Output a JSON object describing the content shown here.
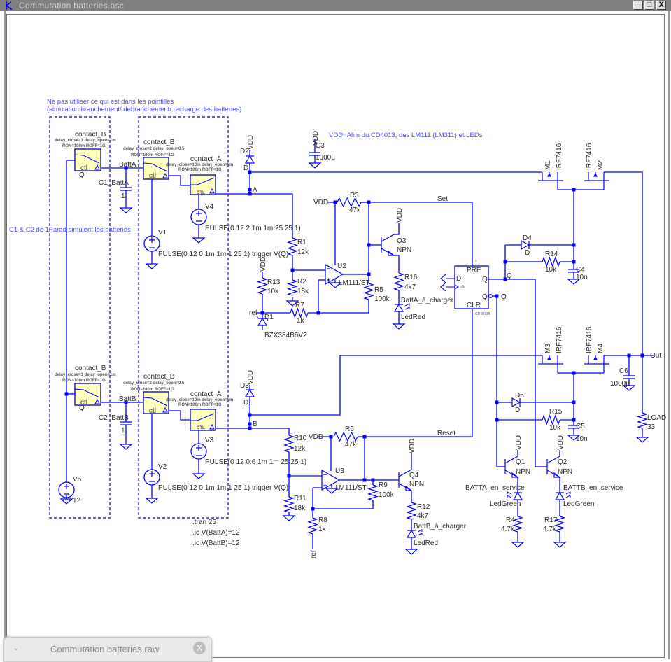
{
  "window": {
    "title": "Commutation batteries.asc",
    "buttons": {
      "minimize": "_",
      "maximize": "□",
      "close": "X"
    }
  },
  "bottom_tab": {
    "title": "Commutation batteries.raw",
    "close": "X",
    "chevron": "⌄"
  },
  "colors": {
    "wire": "#0000ff",
    "comment": "#4848ff",
    "switch_fill": "#ffffc0",
    "titlebar": "#808080"
  },
  "comments": {
    "note1": "Ne pas utiliser ce qui est dans les pointilles",
    "note2": "(simulation branchement/ debranchement/ recharge des batteries)",
    "note3": "C1 & C2 de 1Farad simulent les batteries",
    "note4": "VDD=Alim du CD4013, des LM111 (LM311) et LEDs"
  },
  "directives": {
    "tran": ".tran 25",
    "ic_a": ".ic V(BattA)=12",
    "ic_b": ".ic V(BattB)=12"
  },
  "switches": {
    "sw1": {
      "name": "contact_B",
      "p1": "delay_close=1 delay_open=1m",
      "p2": "RON=100m ROFF=1G",
      "ctl": "ctl",
      "pin": "Q̄"
    },
    "sw2": {
      "name": "contact_B",
      "p1": "delay_close=2 delay_open=0.5",
      "p2": "RON=100m ROFF=1G",
      "ctl": "ctl"
    },
    "sw3": {
      "name": "contact_A",
      "p1": "delay_close=10m delay_open=5m",
      "p2": "RON=100m ROFF=1G",
      "ctl": "CTL"
    },
    "sw4": {
      "name": "contact_B",
      "p1": "delay_close=1 delay_open=1m",
      "p2": "RON=100m ROFF=1G",
      "ctl": "ctl",
      "pin": "Q"
    },
    "sw5": {
      "name": "contact_B",
      "p1": "delay_close=2 delay_open=0.5",
      "p2": "RON=100m ROFF=1G",
      "ctl": "ctl"
    },
    "sw6": {
      "name": "contact_A",
      "p1": "delay_close=10m delay_open=5m",
      "p2": "RON=100m ROFF=1G",
      "ctl": "CTL"
    }
  },
  "nets": {
    "batta": "BattA",
    "battb": "BattB",
    "a": "A",
    "b": "B",
    "set": "Set",
    "reset": "Reset",
    "q": "Q",
    "qbar": "Q̄",
    "out": "Out",
    "ref1": "ref",
    "ref2": "ref"
  },
  "sources": {
    "v1": {
      "name": "V1",
      "value": "PULSE(0 12 0 1m 1m 1 25 1) trigger V(Q)"
    },
    "v2": {
      "name": "V2",
      "value": "PULSE(0 12 0 1m 1m 1 25 1) trigger V̄(Q)"
    },
    "v3": {
      "name": "V3",
      "value": "PULSE(0 12 0.6 1m 1m 25 25 1)"
    },
    "v4": {
      "name": "V4",
      "value": "PULSE(0 12 2 1m 1m 25 25 1)"
    },
    "v5": {
      "name": "V5",
      "value": "12"
    }
  },
  "capacitors": {
    "c1": {
      "name": "C1_BattA",
      "value": "1"
    },
    "c2": {
      "name": "C2_BattB",
      "value": "1"
    },
    "c3": {
      "name": "C3",
      "value": "1000µ"
    },
    "c4": {
      "name": "C4",
      "value": "10n"
    },
    "c5": {
      "name": "C5",
      "value": "10n"
    },
    "c6": {
      "name": "C6",
      "value": "1000µ"
    }
  },
  "resistors": {
    "r1": {
      "name": "R1",
      "value": "12k"
    },
    "r2": {
      "name": "R2",
      "value": "18k"
    },
    "r3": {
      "name": "R3",
      "value": "47k"
    },
    "r4": {
      "name": "R4",
      "value": "4.7k"
    },
    "r5": {
      "name": "R5",
      "value": "100k"
    },
    "r6": {
      "name": "R6",
      "value": "47k"
    },
    "r7": {
      "name": "R7",
      "value": "1k"
    },
    "r8": {
      "name": "R8",
      "value": "1k"
    },
    "r9": {
      "name": "R9",
      "value": "100k"
    },
    "r10": {
      "name": "R10",
      "value": "12k"
    },
    "r11": {
      "name": "R11",
      "value": "18k"
    },
    "r12": {
      "name": "R12",
      "value": "4k7"
    },
    "r13": {
      "name": "R13",
      "value": "10k"
    },
    "r14": {
      "name": "R14",
      "value": "10k"
    },
    "r15": {
      "name": "R15",
      "value": "10k"
    },
    "r16": {
      "name": "R16",
      "value": "4k7"
    },
    "r17": {
      "name": "R17",
      "value": "4.7k"
    },
    "load": {
      "name": "LOAD",
      "value": "33"
    }
  },
  "diodes": {
    "d1": {
      "name": "D1",
      "value": "BZX384B6V2"
    },
    "d2": {
      "name": "D2",
      "value": "D"
    },
    "d3": {
      "name": "D3",
      "value": "D"
    },
    "d4": {
      "name": "D4",
      "value": "D"
    },
    "d5": {
      "name": "D5",
      "value": "D"
    },
    "led_a_charge": {
      "name": "BattA_à_charger",
      "value": "LedRed"
    },
    "led_b_charge": {
      "name": "BattB_à_charger",
      "value": "LedRed"
    },
    "led_a_service": {
      "name": "BATTA_en_service",
      "value": "LedGreen"
    },
    "led_b_service": {
      "name": "BATTB_en_service",
      "value": "LedGreen"
    }
  },
  "transistors": {
    "q1": {
      "name": "Q1",
      "value": "NPN"
    },
    "q2": {
      "name": "Q2",
      "value": "NPN"
    },
    "q3": {
      "name": "Q3",
      "value": "NPN"
    },
    "q4": {
      "name": "Q4",
      "value": "NPN"
    },
    "m1": {
      "name": "M1",
      "value": "IRF7416"
    },
    "m2": {
      "name": "M2",
      "value": "IRF7416"
    },
    "m3": {
      "name": "M3",
      "value": "IRF7416"
    },
    "m4": {
      "name": "M4",
      "value": "IRF7416"
    }
  },
  "opamps": {
    "u2": {
      "name": "U2",
      "value": "LM111/ST"
    },
    "u3": {
      "name": "U3",
      "value": "LM111/ST"
    }
  },
  "flipflop": {
    "part": "CD4013B",
    "pre": "PRE",
    "clr": "CLR",
    "d": "D",
    "q": "Q",
    "qbar": "Q̄",
    "clk": "clk",
    "s": "s"
  },
  "vdd": {
    "d2": "VDD",
    "c3": "VDD",
    "d3": "VDD",
    "r3": "VDD",
    "r6": "VDD",
    "q3": "VDD",
    "q4": "VDD",
    "r13": "VDD",
    "q1": "VDD",
    "q2": "VDD"
  }
}
